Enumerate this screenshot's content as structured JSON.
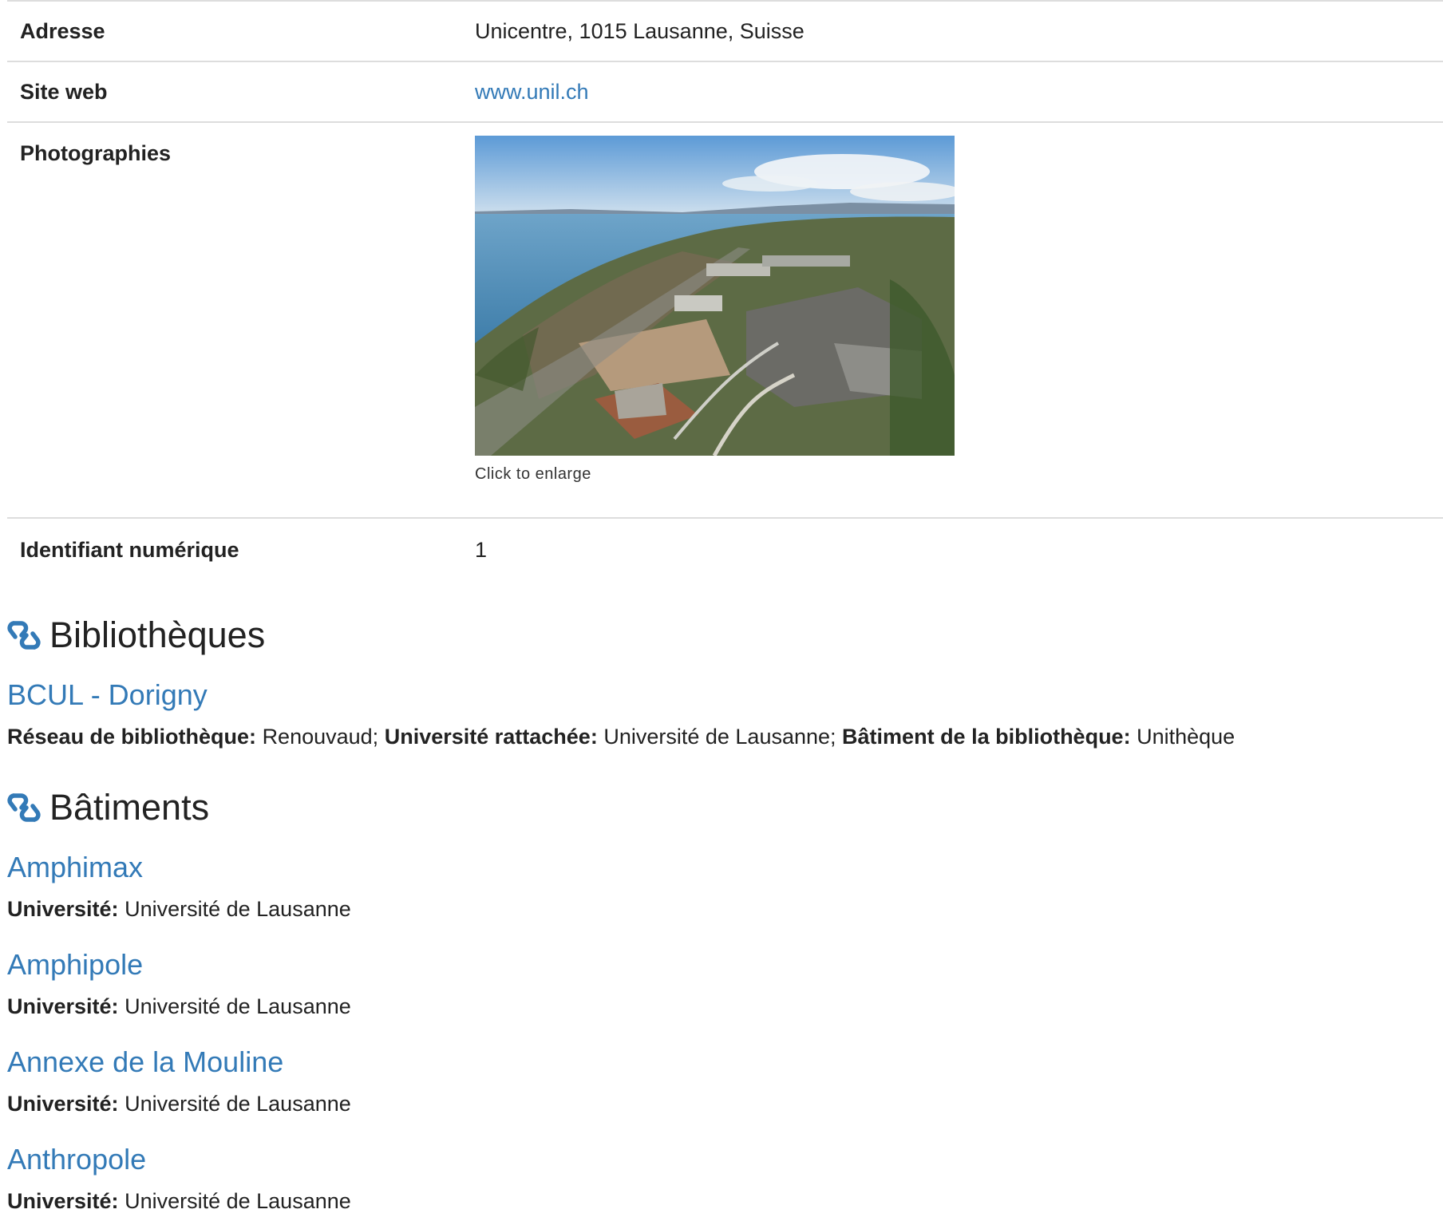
{
  "details": {
    "address_label": "Adresse",
    "address_value": "Unicentre, 1015 Lausanne, Suisse",
    "website_label": "Site web",
    "website_value": "www.unil.ch",
    "photos_label": "Photographies",
    "photo_caption": "Click to enlarge",
    "id_label": "Identifiant numérique",
    "id_value": "1"
  },
  "libraries": {
    "heading": "Bibliothèques",
    "items": [
      {
        "title": "BCUL - Dorigny",
        "network_label": "Réseau de bibliothèque:",
        "network_value": "Renouvaud;",
        "university_label": "Université rattachée:",
        "university_value": "Université de Lausanne;",
        "building_label": "Bâtiment de la bibliothèque:",
        "building_value": "Unithèque"
      }
    ]
  },
  "buildings": {
    "heading": "Bâtiments",
    "items": [
      {
        "title": "Amphimax",
        "university_label": "Université:",
        "university_value": "Université de Lausanne"
      },
      {
        "title": "Amphipole",
        "university_label": "Université:",
        "university_value": "Université de Lausanne"
      },
      {
        "title": "Annexe de la Mouline",
        "university_label": "Université:",
        "university_value": "Université de Lausanne"
      },
      {
        "title": "Anthropole",
        "university_label": "Université:",
        "university_value": "Université de Lausanne"
      }
    ]
  },
  "colors": {
    "link": "#337ab7",
    "border": "#dddddd",
    "text": "#222222"
  },
  "icons": {
    "section_icon": "link-chain-icon"
  }
}
